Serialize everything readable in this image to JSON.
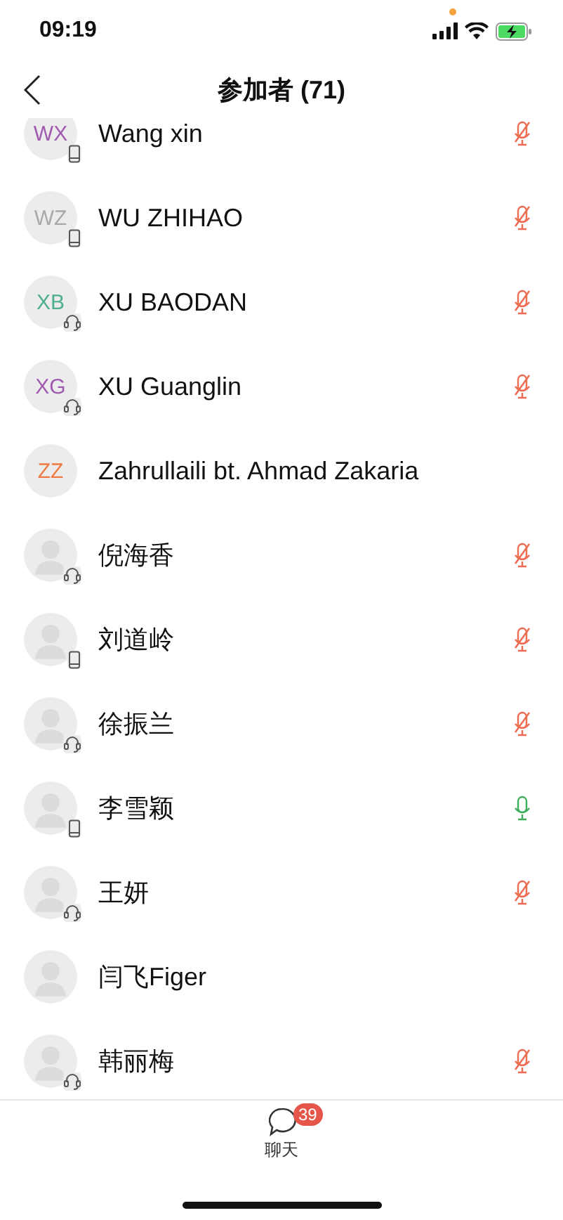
{
  "status_bar": {
    "time": "09:19"
  },
  "nav": {
    "title": "参加者 (71)"
  },
  "participants": [
    {
      "name": "Wang xin",
      "initials": "WX",
      "color": "#a05ab0",
      "device": {
        "kind": "phone"
      },
      "mic": {
        "muted": true
      }
    },
    {
      "name": "WU ZHIHAO",
      "initials": "WZ",
      "color": "#a9a9a9",
      "device": {
        "kind": "phone"
      },
      "mic": {
        "muted": true
      }
    },
    {
      "name": "XU BAODAN",
      "initials": "XB",
      "color": "#4fae8e",
      "device": {
        "kind": "headset"
      },
      "mic": {
        "muted": true
      }
    },
    {
      "name": "XU Guanglin",
      "initials": "XG",
      "color": "#a05ab0",
      "device": {
        "kind": "headset"
      },
      "mic": {
        "muted": true
      }
    },
    {
      "name": "Zahrullaili bt. Ahmad Zakaria",
      "initials": "ZZ",
      "color": "#f07a45"
    },
    {
      "name": "倪海香",
      "device": {
        "kind": "headset"
      },
      "mic": {
        "muted": true
      }
    },
    {
      "name": "刘道岭",
      "device": {
        "kind": "phone"
      },
      "mic": {
        "muted": true
      }
    },
    {
      "name": "徐振兰",
      "device": {
        "kind": "headset"
      },
      "mic": {
        "muted": true
      }
    },
    {
      "name": "李雪颖",
      "device": {
        "kind": "phone"
      },
      "mic": {
        "muted": false
      }
    },
    {
      "name": "王妍",
      "device": {
        "kind": "headset"
      },
      "mic": {
        "muted": true
      }
    },
    {
      "name": "闫飞Figer"
    },
    {
      "name": "韩丽梅",
      "device": {
        "kind": "headset"
      },
      "mic": {
        "muted": true
      }
    }
  ],
  "tab_bar": {
    "label": "聊天",
    "badge": "39"
  }
}
